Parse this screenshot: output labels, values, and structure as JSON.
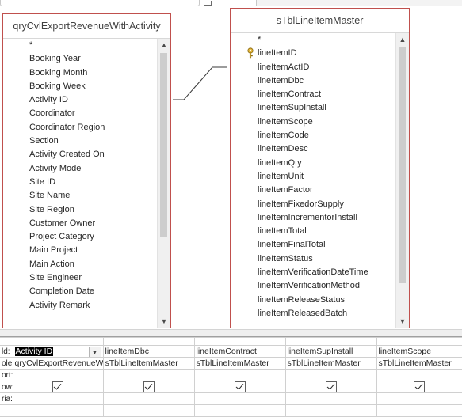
{
  "query_name": "qryCvlExportRevenueWithActivity",
  "table_name": "sTblLineItemMaster",
  "left_fields": [
    "*",
    "Booking Year",
    "Booking Month",
    "Booking Week",
    "Activity ID",
    "Coordinator",
    "Coordinator Region",
    "Section",
    "Activity Created On",
    "Activity Mode",
    "Site ID",
    "Site Name",
    "Site Region",
    "Customer Owner",
    "Project Category",
    "Main Project",
    "Main Action",
    "Site Engineer",
    "Completion Date",
    "Activity Remark"
  ],
  "right_fields": [
    "*",
    "lineItemID",
    "lineItemActID",
    "lineItemDbc",
    "lineItemContract",
    "lineItemSupInstall",
    "lineItemScope",
    "lineItemCode",
    "lineItemDesc",
    "lineItemQty",
    "lineItemUnit",
    "lineItemFactor",
    "lineItemFixedorSupply",
    "lineItemIncrementorInstall",
    "lineItemTotal",
    "lineItemFinalTotal",
    "lineItemStatus",
    "lineItemVerificationDateTime",
    "lineItemVerificationMethod",
    "lineItemReleaseStatus",
    "lineItemReleasedBatch"
  ],
  "grid": {
    "row_labels": [
      "ld:",
      "ole:",
      "ort:",
      "ow:",
      "ria:"
    ],
    "columns": [
      {
        "field": "Activity ID",
        "table": "qryCvlExportRevenueWi",
        "show": true
      },
      {
        "field": "lineItemDbc",
        "table": "sTblLineItemMaster",
        "show": true
      },
      {
        "field": "lineItemContract",
        "table": "sTblLineItemMaster",
        "show": true
      },
      {
        "field": "lineItemSupInstall",
        "table": "sTblLineItemMaster",
        "show": true
      },
      {
        "field": "lineItemScope",
        "table": "sTblLineItemMaster",
        "show": true
      }
    ]
  },
  "icons": {
    "key": "primary-key-icon",
    "dropdown": "chevron-down-icon",
    "scroll_up": "triangle-up-icon",
    "scroll_down": "triangle-down-icon"
  },
  "colors": {
    "table_border": "#c0504d",
    "selection": "#000000"
  }
}
